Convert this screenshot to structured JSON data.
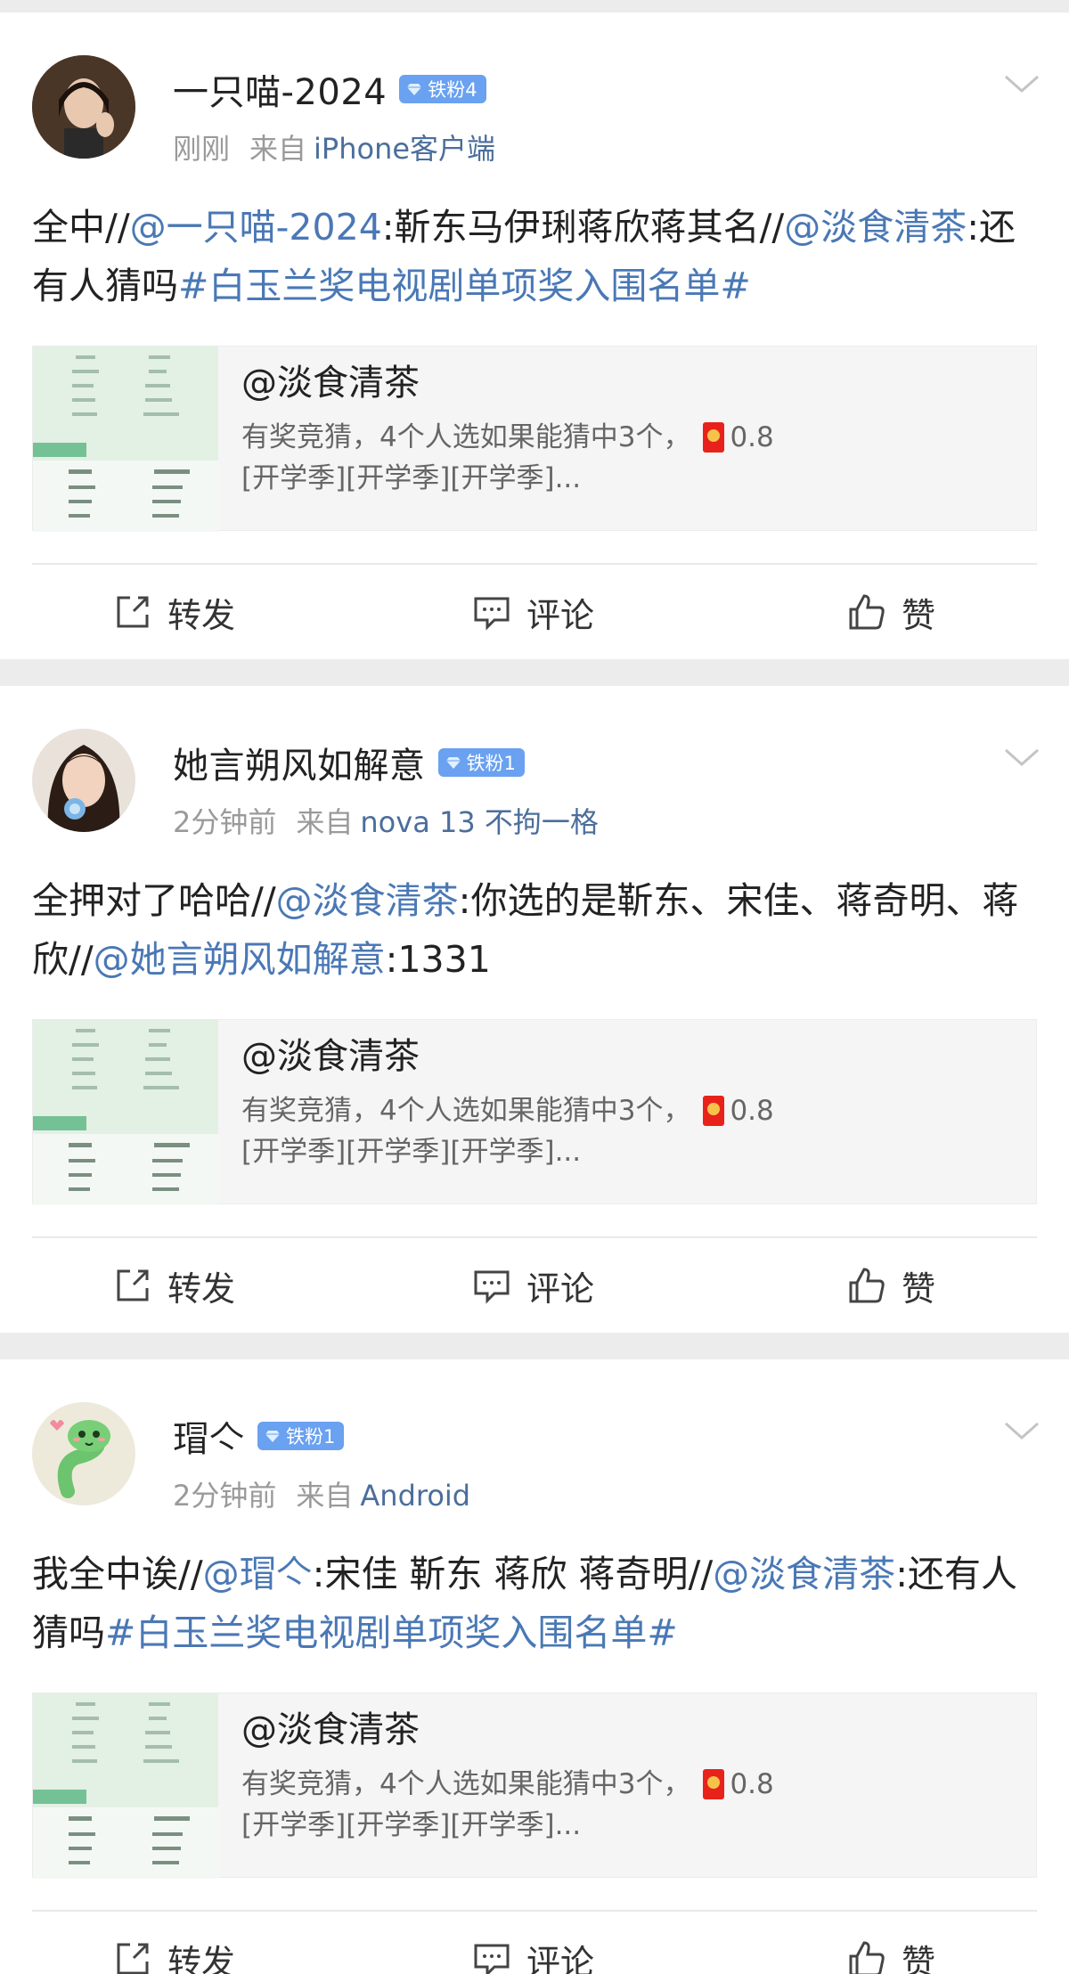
{
  "posts": [
    {
      "username": "一只喵-2024",
      "badge": "铁粉4",
      "time": "刚刚",
      "source_label": "来自",
      "source": "iPhone客户端",
      "body": [
        {
          "t": "text",
          "v": "全中//"
        },
        {
          "t": "link",
          "v": "@一只喵-2024"
        },
        {
          "t": "text",
          "v": ":靳东马伊琍蒋欣蒋其名//"
        },
        {
          "t": "link",
          "v": "@淡食清茶"
        },
        {
          "t": "text",
          "v": ":还有人猜吗"
        },
        {
          "t": "link",
          "v": "#白玉兰奖电视剧单项奖入围名单#"
        }
      ],
      "quote": {
        "title": "@淡食清茶",
        "desc": "有奖竞猜，4个人选如果能猜中3个，",
        "amount": "0.8",
        "tags": "[开学季][开学季][开学季]..."
      },
      "actions": {
        "forward": "转发",
        "comment": "评论",
        "like": "赞"
      }
    },
    {
      "username": "她言朔风如解意",
      "badge": "铁粉1",
      "time": "2分钟前",
      "source_label": "来自",
      "source": "nova 13 不拘一格",
      "body": [
        {
          "t": "text",
          "v": "全押对了哈哈//"
        },
        {
          "t": "link",
          "v": "@淡食清茶"
        },
        {
          "t": "text",
          "v": ":你选的是靳东、宋佳、蒋奇明、蒋欣//"
        },
        {
          "t": "link",
          "v": "@她言朔风如解意"
        },
        {
          "t": "text",
          "v": ":1331"
        }
      ],
      "quote": {
        "title": "@淡食清茶",
        "desc": "有奖竞猜，4个人选如果能猜中3个，",
        "amount": "0.8",
        "tags": "[开学季][开学季][开学季]..."
      },
      "actions": {
        "forward": "转发",
        "comment": "评论",
        "like": "赞"
      }
    },
    {
      "username": "瑁亽",
      "badge": "铁粉1",
      "time": "2分钟前",
      "source_label": "来自",
      "source": "Android",
      "body": [
        {
          "t": "text",
          "v": "我全中诶//"
        },
        {
          "t": "link",
          "v": "@瑁亽"
        },
        {
          "t": "text",
          "v": ":宋佳 靳东 蒋欣 蒋奇明//"
        },
        {
          "t": "link",
          "v": "@淡食清茶"
        },
        {
          "t": "text",
          "v": ":还有人猜吗"
        },
        {
          "t": "link",
          "v": "#白玉兰奖电视剧单项奖入围名单#"
        }
      ],
      "quote": {
        "title": "@淡食清茶",
        "desc": "有奖竞猜，4个人选如果能猜中3个，",
        "amount": "0.8",
        "tags": "[开学季][开学季][开学季]..."
      },
      "actions": {
        "forward": "转发",
        "comment": "评论",
        "like": "赞"
      }
    }
  ],
  "colors": {
    "link": "#4a78b5",
    "badge": "#6aa1f0",
    "source": "#4b6e9c",
    "red_packet": "#e8221b"
  }
}
